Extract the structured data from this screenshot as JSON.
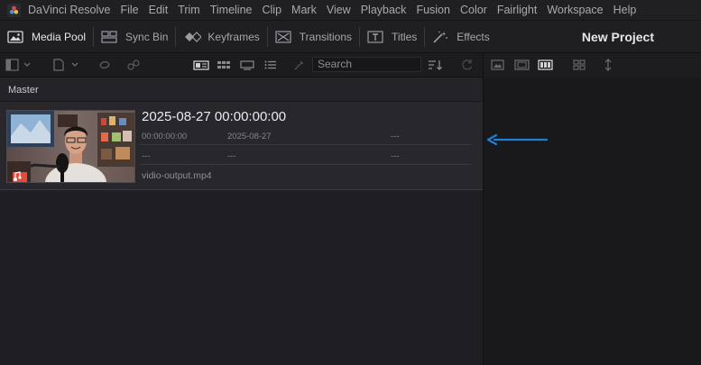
{
  "menubar": {
    "app_name": "DaVinci Resolve",
    "items": [
      "File",
      "Edit",
      "Trim",
      "Timeline",
      "Clip",
      "Mark",
      "View",
      "Playback",
      "Fusion",
      "Color",
      "Fairlight",
      "Workspace",
      "Help"
    ]
  },
  "toolbar": {
    "media_pool": "Media Pool",
    "sync_bin": "Sync Bin",
    "keyframes": "Keyframes",
    "transitions": "Transitions",
    "titles": "Titles",
    "effects": "Effects",
    "project_title": "New Project"
  },
  "subbar": {
    "search_placeholder": "Search"
  },
  "bin": {
    "title": "Master"
  },
  "clip": {
    "title": "2025-08-27  00:00:00:00",
    "timecode": "00:00:00:00",
    "date": "2025-08-27",
    "placeholder": "---",
    "filename": "vidio-output.mp4"
  },
  "colors": {
    "arrow": "#1f7fd6",
    "accent_text": "#eaeaee"
  }
}
